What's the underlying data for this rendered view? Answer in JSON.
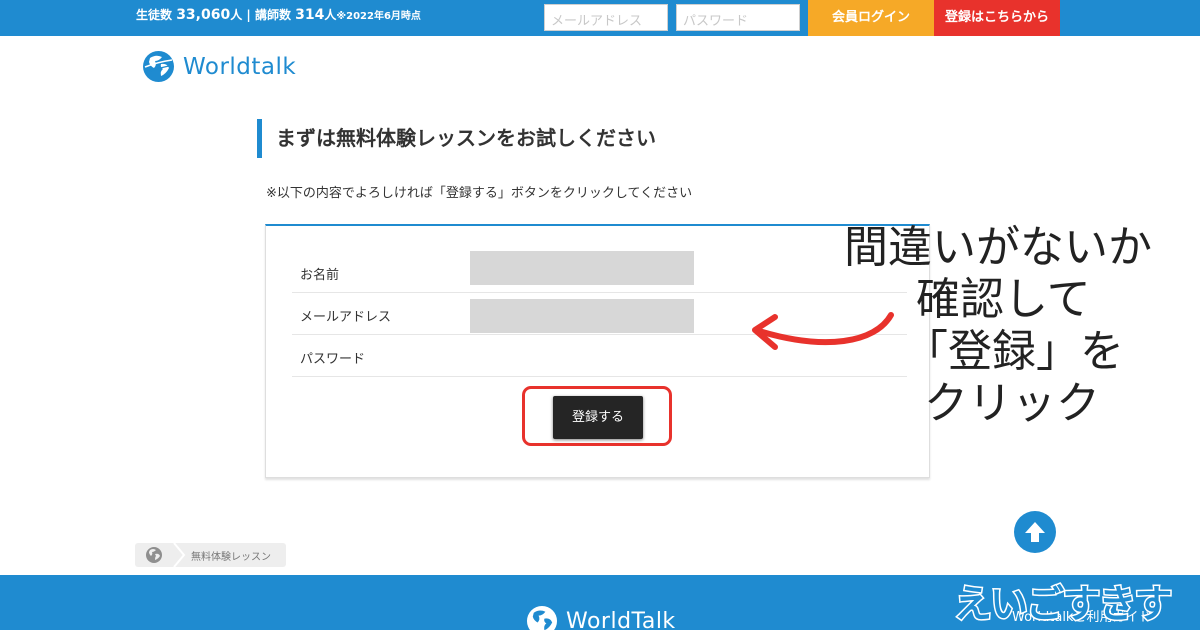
{
  "topbar": {
    "stats_prefix": "生徒数 ",
    "students_count": "33,060",
    "students_suffix": "人 | 講師数 ",
    "teachers_count": "314",
    "teachers_suffix": "人",
    "stats_note": "※2022年6月時点",
    "email_placeholder": "メールアドレス",
    "password_placeholder": "パスワード",
    "login_label": "会員ログイン",
    "register_label": "登録はこちらから"
  },
  "brand": {
    "logo_text": "Worldtalk",
    "logo_icon": "globe-icon",
    "accent_color": "#1f8bd0"
  },
  "main": {
    "title": "まずは無料体験レッスンをお試しください",
    "instruction": "※以下の内容でよろしければ「登録する」ボタンをクリックしてください",
    "fields": [
      {
        "label": "お名前"
      },
      {
        "label": "メールアドレス"
      },
      {
        "label": "パスワード"
      }
    ],
    "submit_label": "登録する"
  },
  "annotation": {
    "lines": [
      "間違いがないか",
      "確認して",
      "「登録」を",
      "クリック"
    ],
    "color": "#e8322c"
  },
  "breadcrumb": {
    "home_icon": "globe-icon",
    "current": "無料体験レッスン"
  },
  "footer": {
    "logo_text": "WorldTalk",
    "link_text": "Worldtalkご利用ガイド"
  },
  "watermark": {
    "text": "えいごすきす"
  }
}
